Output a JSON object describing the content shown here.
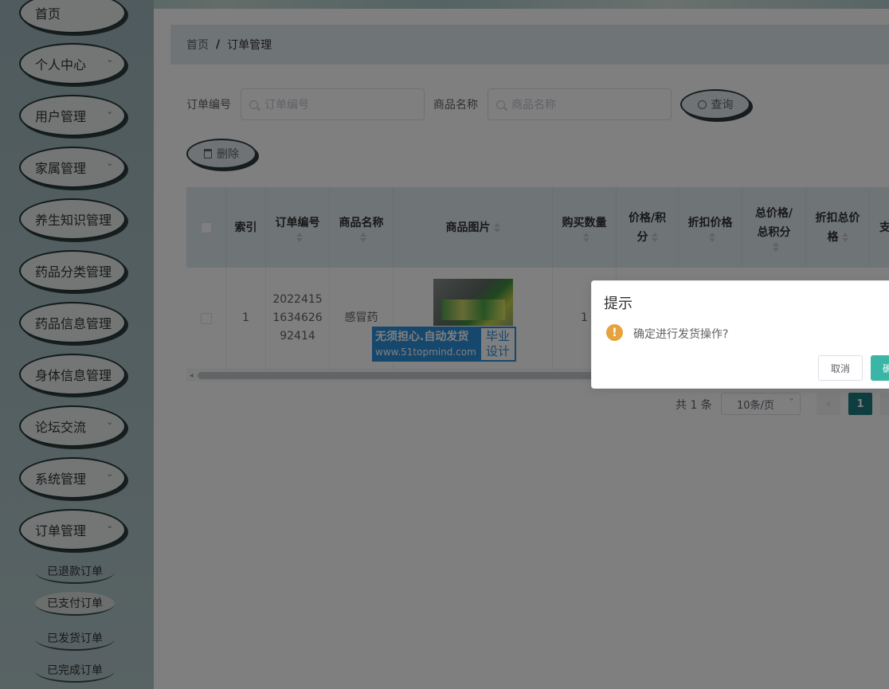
{
  "sidebar": {
    "items": [
      {
        "label": "首页",
        "has_arrow": false
      },
      {
        "label": "个人中心",
        "has_arrow": true
      },
      {
        "label": "用户管理",
        "has_arrow": true
      },
      {
        "label": "家属管理",
        "has_arrow": true
      },
      {
        "label": "养生知识管理",
        "has_arrow": true
      },
      {
        "label": "药品分类管理",
        "has_arrow": true
      },
      {
        "label": "药品信息管理",
        "has_arrow": true
      },
      {
        "label": "身体信息管理",
        "has_arrow": true
      },
      {
        "label": "论坛交流",
        "has_arrow": true
      },
      {
        "label": "系统管理",
        "has_arrow": true
      },
      {
        "label": "订单管理",
        "has_arrow": true
      }
    ],
    "submenu": [
      {
        "label": "已退款订单",
        "active": false
      },
      {
        "label": "已支付订单",
        "active": true
      },
      {
        "label": "已发货订单",
        "active": false
      },
      {
        "label": "已完成订单",
        "active": false
      }
    ]
  },
  "breadcrumb": {
    "home": "首页",
    "separator": "/",
    "current": "订单管理"
  },
  "search": {
    "order_no_label": "订单编号",
    "order_no_placeholder": "订单编号",
    "product_label": "商品名称",
    "product_placeholder": "商品名称",
    "query_button": "查询"
  },
  "actions": {
    "delete_button": "删除"
  },
  "table": {
    "headers": {
      "index": "索引",
      "order_no": "订单编号",
      "product_name": "商品名称",
      "product_image": "商品图片",
      "quantity": "购买数量",
      "price_l1": "价格/积",
      "price_l2": "分",
      "discount_price": "折扣价格",
      "total_l1": "总价格/",
      "total_l2": "总积分",
      "discount_total_l1": "折扣总价",
      "discount_total_l2": "格",
      "pay_partial": "支"
    },
    "rows": [
      {
        "index": "1",
        "order_no_l1": "2022415",
        "order_no_l2": "1634626",
        "order_no_l3": "92414",
        "product_name": "感冒药",
        "quantity": "1"
      }
    ]
  },
  "watermark": {
    "line1": "无须担心.自动发货",
    "line2": "www.51topmind.com",
    "right1": "毕业",
    "right2": "设计"
  },
  "pagination": {
    "total": "共 1 条",
    "page_size": "10条/页",
    "current_page": "1"
  },
  "dialog": {
    "title": "提示",
    "icon": "!",
    "message": "确定进行发货操作?",
    "cancel": "取消",
    "confirm": "确定"
  },
  "colors": {
    "accent": "#1d7c80",
    "confirm": "#3bb6a6",
    "warning": "#e6a23c",
    "header_bg": "#dfe9ec"
  }
}
